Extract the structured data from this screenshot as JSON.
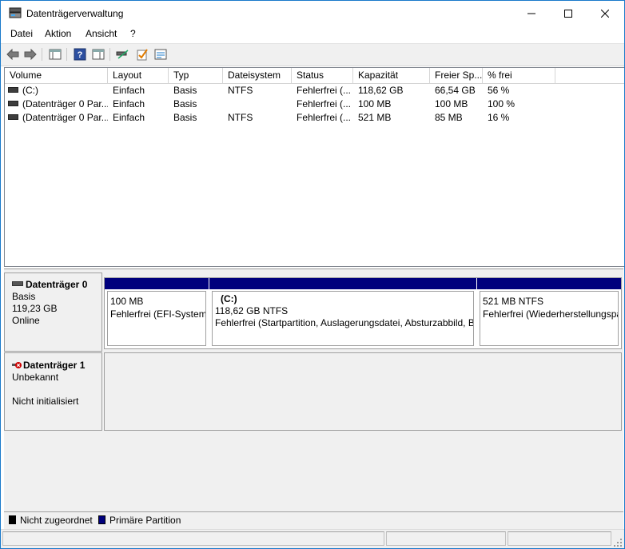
{
  "window": {
    "title": "Datenträgerverwaltung"
  },
  "menu": [
    {
      "label": "Datei"
    },
    {
      "label": "Aktion"
    },
    {
      "label": "Ansicht"
    },
    {
      "label": "?"
    }
  ],
  "toolbar": {
    "buttons": [
      "back-icon",
      "forward-icon",
      "console-tree-icon",
      "help-icon",
      "properties-icon",
      "rescan-icon",
      "check-icon",
      "list-icon"
    ]
  },
  "volumes": {
    "columns": [
      "Volume",
      "Layout",
      "Typ",
      "Dateisystem",
      "Status",
      "Kapazität",
      "Freier Sp...",
      "% frei"
    ],
    "rows": [
      [
        "(C:)",
        "Einfach",
        "Basis",
        "NTFS",
        "Fehlerfrei (...",
        "118,62 GB",
        "66,54 GB",
        "56 %"
      ],
      [
        "(Datenträger 0 Par...",
        "Einfach",
        "Basis",
        "",
        "Fehlerfrei (...",
        "100 MB",
        "100 MB",
        "100 %"
      ],
      [
        "(Datenträger 0 Par...",
        "Einfach",
        "Basis",
        "NTFS",
        "Fehlerfrei (...",
        "521 MB",
        "85 MB",
        "16 %"
      ]
    ]
  },
  "disks": [
    {
      "name": "Datenträger 0",
      "type": "Basis",
      "size": "119,23 GB",
      "state": "Online",
      "partitions": [
        {
          "title": "",
          "size": "100 MB",
          "status": "Fehlerfrei (EFI-Systempartition)"
        },
        {
          "title": "(C:)",
          "size": "118,62 GB NTFS",
          "status": "Fehlerfrei (Startpartition, Auslagerungsdatei, Absturzabbild, B"
        },
        {
          "title": "",
          "size": "521 MB NTFS",
          "status": "Fehlerfrei (Wiederherstellungspartition)"
        }
      ]
    },
    {
      "name": "Datenträger 1",
      "type": "Unbekannt",
      "size": "",
      "state": "Nicht initialisiert",
      "partitions": []
    }
  ],
  "legend": [
    {
      "label": "Nicht zugeordnet",
      "color": "#000000"
    },
    {
      "label": "Primäre Partition",
      "color": "#00007d"
    }
  ],
  "colors": {
    "primary_partition": "#00007d",
    "unallocated": "#000000",
    "window_border": "#1979ca"
  }
}
